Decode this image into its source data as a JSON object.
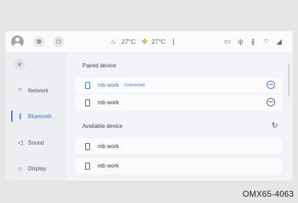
{
  "statusbar": {
    "left_icons": [
      "avatar-icon",
      "fan-icon",
      "power-icon"
    ],
    "seat_icon": "seat-heat-icon",
    "temp_left": "27°C",
    "fan_icon": "fan-speed-icon",
    "temp_right": "27°C",
    "seat_icon_right": "seat-icon",
    "right_icons": [
      "screen-icon",
      "usb-icon",
      "bluetooth-icon",
      "wifi-icon",
      "signal-icon"
    ]
  },
  "sidebar": {
    "close_icon": "×",
    "items": [
      {
        "label": "Network",
        "icon": "wifi-icon",
        "glyph": "⌔",
        "active": false
      },
      {
        "label": "Bluetooth",
        "icon": "bluetooth-icon",
        "glyph": "∦",
        "active": true
      },
      {
        "label": "Sound",
        "icon": "speaker-icon",
        "glyph": "◁",
        "active": false
      },
      {
        "label": "Display",
        "icon": "brightness-icon",
        "glyph": "☼",
        "active": false
      }
    ]
  },
  "paired": {
    "title": "Paired device",
    "devices": [
      {
        "name": "mb work",
        "status": "Connected",
        "connected": true
      },
      {
        "name": "mb work",
        "status": "",
        "connected": false
      }
    ]
  },
  "available": {
    "title": "Available device",
    "refresh_icon": "↻",
    "devices": [
      {
        "name": "mb work"
      },
      {
        "name": "mb work"
      }
    ]
  },
  "watermark": "OMX65-4063",
  "colors": {
    "accent": "#3c78d8",
    "background": "#f2f3f6"
  }
}
